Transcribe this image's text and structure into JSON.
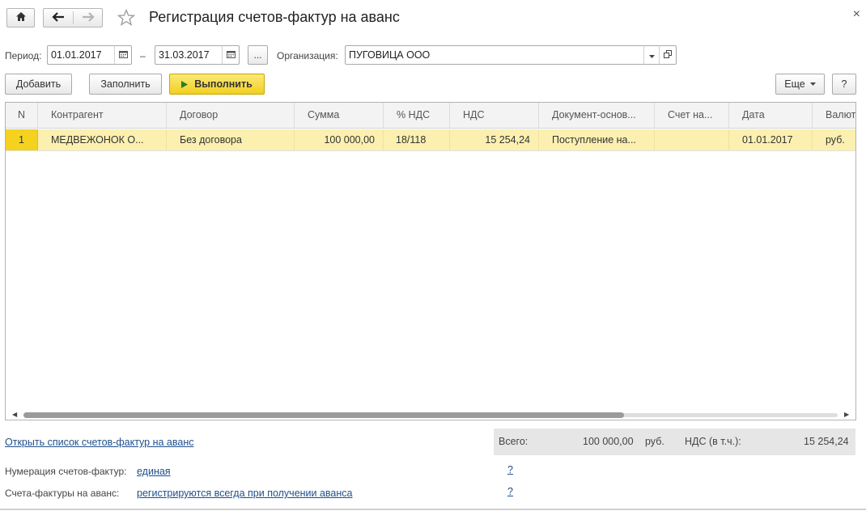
{
  "header": {
    "title": "Регистрация счетов-фактур на аванс",
    "close": "×"
  },
  "filters": {
    "period_label": "Период:",
    "date_from": "01.01.2017",
    "date_sep": "–",
    "date_to": "31.03.2017",
    "dots": "...",
    "org_label": "Организация:",
    "org_value": "ПУГОВИЦА ООО"
  },
  "toolbar": {
    "add": "Добавить",
    "fill": "Заполнить",
    "run": "Выполнить",
    "more": "Еще",
    "help": "?"
  },
  "table": {
    "columns": [
      "N",
      "Контрагент",
      "Договор",
      "Сумма",
      "% НДС",
      "НДС",
      "Документ-основ...",
      "Счет на...",
      "Дата",
      "Валют"
    ],
    "rows": [
      {
        "n": "1",
        "counterparty": "МЕДВЕЖОНОК О...",
        "contract": "Без договора",
        "sum": "100 000,00",
        "vat_rate": "18/118",
        "vat": "15 254,24",
        "base_doc": "Поступление на...",
        "invoice": "",
        "date": "01.01.2017",
        "currency": "руб."
      }
    ]
  },
  "footer": {
    "open_list": "Открыть список счетов-фактур на аванс",
    "total_label": "Всего:",
    "total_value": "100 000,00",
    "total_currency": "руб.",
    "vat_label": "НДС (в т.ч.):",
    "vat_value": "15 254,24",
    "numbering_label": "Нумерация счетов-фактур:",
    "numbering_value": "единая",
    "invoices_label": "Счета-фактуры на аванс:",
    "invoices_value": "регистрируются всегда при получении аванса",
    "q1": "?",
    "q2": "?"
  },
  "colors": {
    "accent_yellow": "#f4d21f",
    "selected_row": "#fbf0b0",
    "link": "#1f4f8b"
  },
  "icons": [
    "home-icon",
    "back-arrow-icon",
    "forward-arrow-icon",
    "star-icon",
    "calendar-icon",
    "dropdown-icon",
    "open-form-icon",
    "play-icon",
    "chevron-down-icon"
  ]
}
